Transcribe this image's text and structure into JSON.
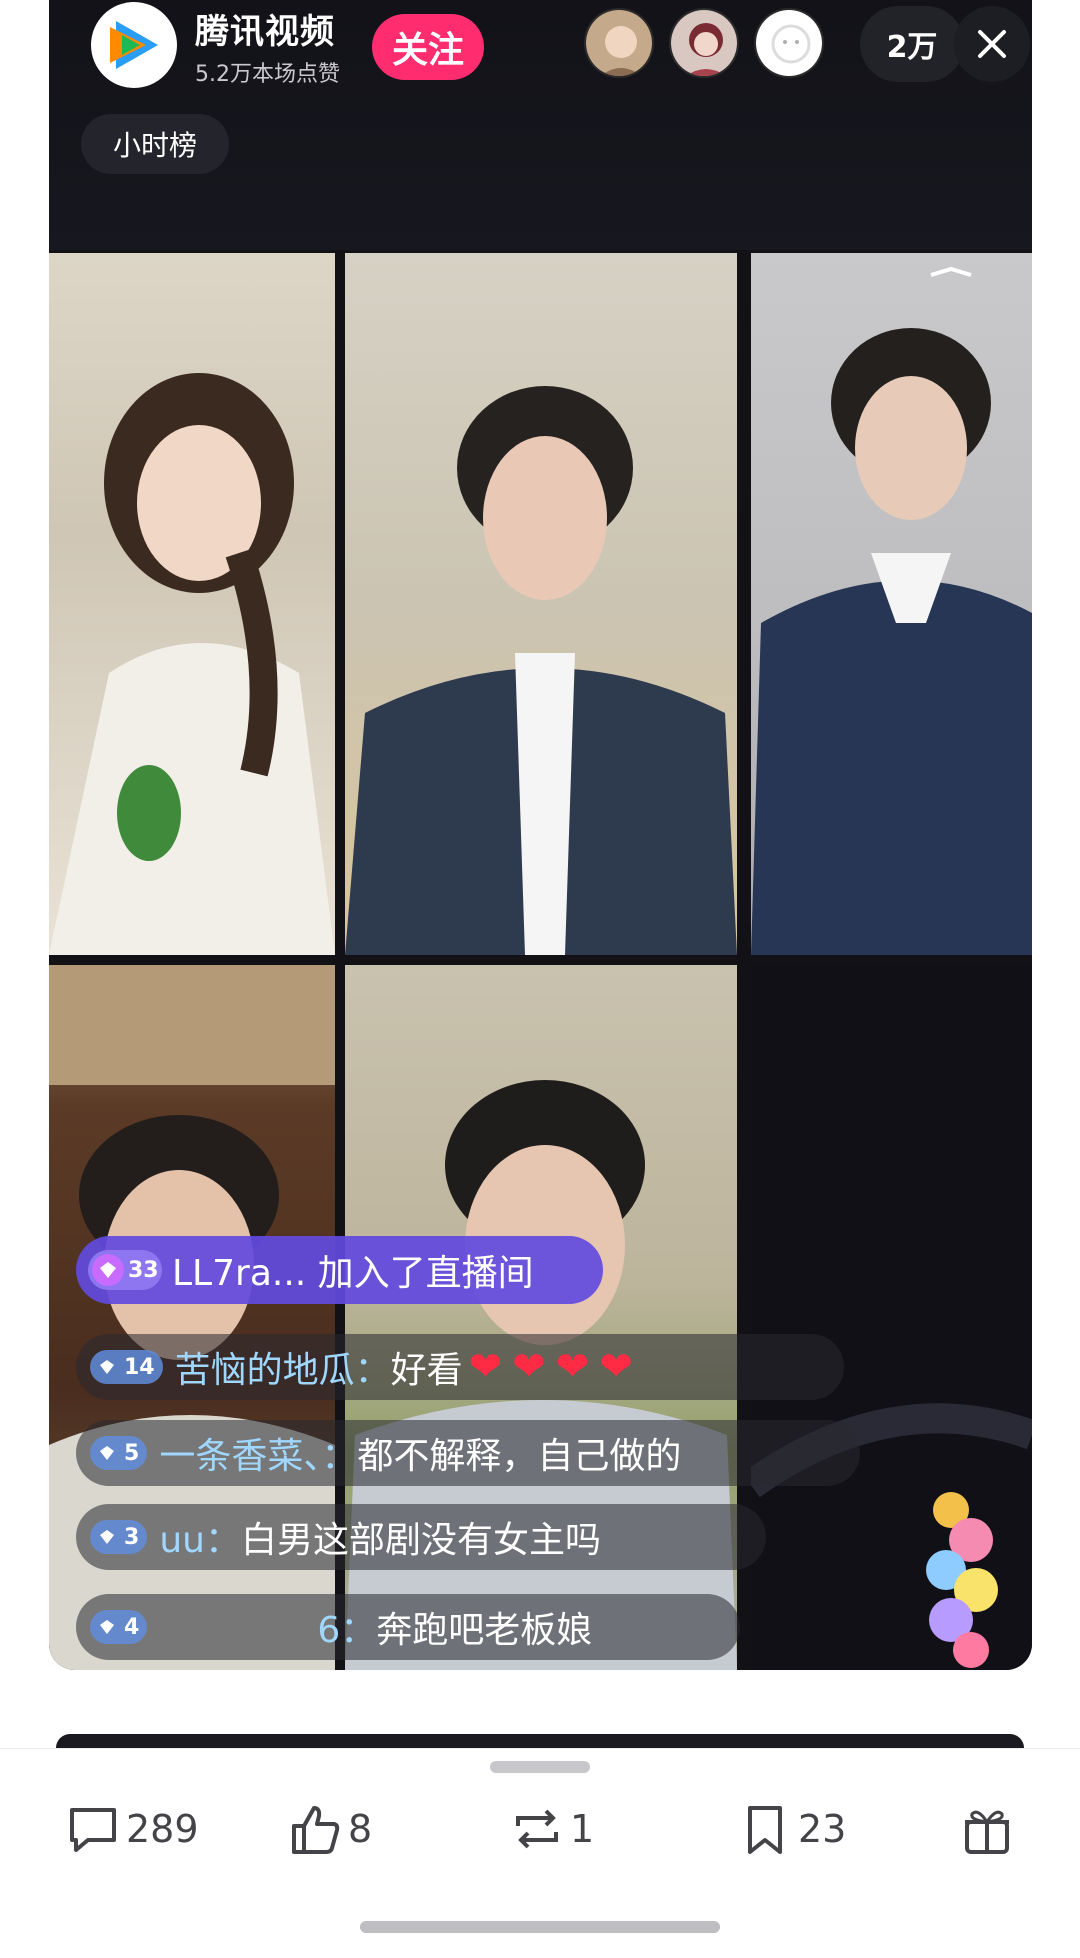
{
  "header": {
    "channel_name": "腾讯视频",
    "likes_text": "5.2万本场点赞",
    "follow_label": "关注",
    "viewer_count": "2万",
    "close_icon": "close-icon",
    "rank_label": "小时榜"
  },
  "comments": {
    "join": {
      "level": "33",
      "user": "LL7ra...",
      "text": "加入了直播间"
    },
    "items": [
      {
        "level": "14",
        "user": "苦恼的地瓜：",
        "text": "好看",
        "hearts": 4
      },
      {
        "level": "5",
        "user": "一条香菜、：",
        "text": "都不解释，自己做的"
      },
      {
        "level": "3",
        "user": "uu：",
        "text": "白男这部剧没有女主吗"
      },
      {
        "level": "4",
        "user": "6：",
        "text": "奔跑吧老板娘"
      }
    ]
  },
  "footer": {
    "comment_count": "289",
    "like_count": "8",
    "repost_count": "1",
    "favorite_count": "23"
  },
  "colors": {
    "follow": "#ff2d6f",
    "join_pill": "#624ade",
    "username": "#9fd7ff",
    "heart": "#ff2a44"
  }
}
